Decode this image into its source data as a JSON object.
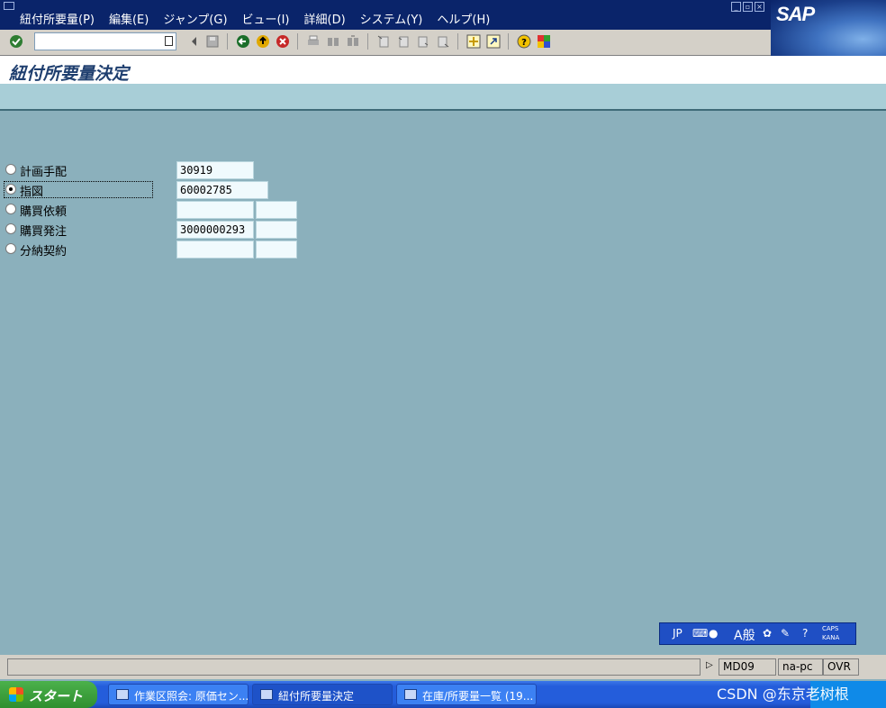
{
  "menubar": {
    "items": [
      "紐付所要量(P)",
      "編集(E)",
      "ジャンプ(G)",
      "ビュー(I)",
      "詳細(D)",
      "システム(Y)",
      "ヘルプ(H)"
    ],
    "logo": "SAP"
  },
  "toolbar": {
    "command_value": "",
    "icons": [
      "enter-check-icon",
      "save-icon",
      "back-icon",
      "exit-icon",
      "cancel-icon",
      "print-icon",
      "find-icon",
      "find-next-icon",
      "first-page-icon",
      "prev-page-icon",
      "next-page-icon",
      "last-page-icon",
      "new-session-icon",
      "shortcut-icon",
      "help-icon",
      "layout-icon"
    ]
  },
  "page": {
    "title": "紐付所要量決定"
  },
  "form": {
    "rows": [
      {
        "label": "計画手配",
        "value": "30919",
        "selected": false,
        "extra_field": false
      },
      {
        "label": "指図",
        "value": "60002785",
        "selected": true,
        "extra_field": false
      },
      {
        "label": "購買依頼",
        "value": "",
        "selected": false,
        "extra_field": true
      },
      {
        "label": "購買発注",
        "value": "3000000293",
        "selected": false,
        "extra_field": true
      },
      {
        "label": "分納契約",
        "value": "",
        "selected": false,
        "extra_field": true
      }
    ]
  },
  "ime": {
    "lang": "JP",
    "mode": "A般",
    "caps": "CAPS",
    "kana": "KANA"
  },
  "status": {
    "tcode": "MD09",
    "host": "na-pc",
    "mode": "OVR"
  },
  "taskbar": {
    "start_label": "スタート",
    "tasks": [
      "作業区照会: 原価セン...",
      "紐付所要量決定",
      "在庫/所要量一覧 (19..."
    ]
  },
  "watermark": "CSDN @东京老树根",
  "colors": {
    "menubar": "#0a246a",
    "background": "#8bb0bc",
    "appbar": "#a8ced7",
    "title": "#1f3f6f"
  }
}
